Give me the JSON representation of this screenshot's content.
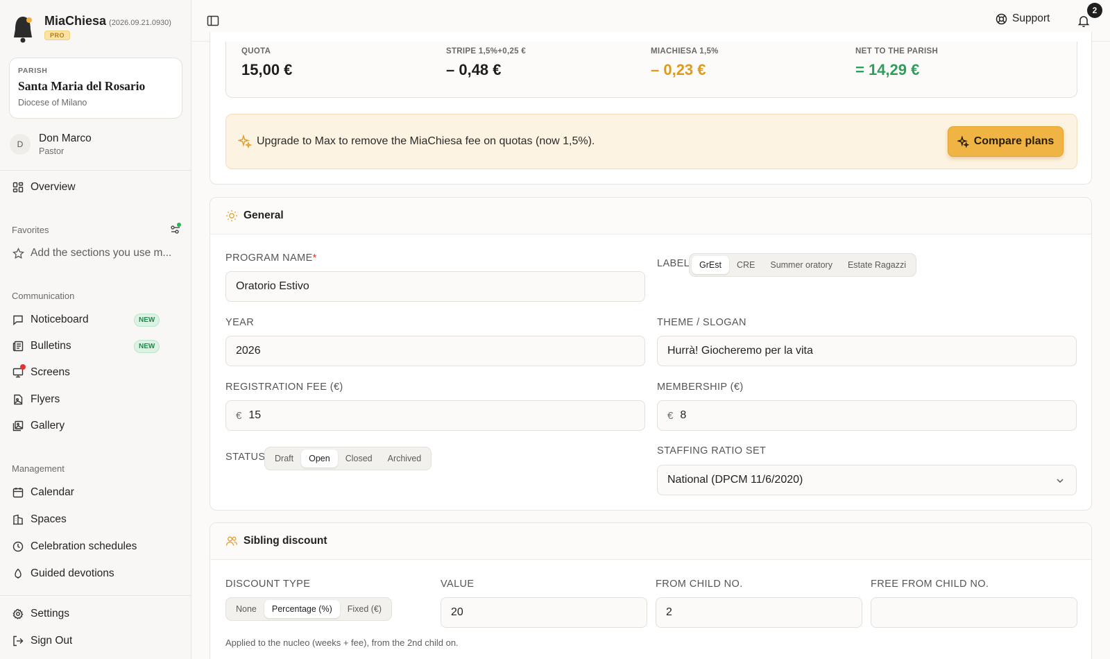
{
  "app": {
    "name": "MiaChiesa",
    "version": "(2026.09.21.0930)",
    "plan_badge": "PRO"
  },
  "parish": {
    "kicker": "PARISH",
    "name": "Santa Maria del Rosario",
    "diocese": "Diocese of Milano"
  },
  "user": {
    "initial": "D",
    "name": "Don Marco",
    "role": "Pastor"
  },
  "sidebar": {
    "overview": "Overview",
    "favorites_title": "Favorites",
    "favorites_hint": "Add the sections you use m...",
    "communication_title": "Communication",
    "communication": [
      {
        "label": "Noticeboard",
        "badge": "NEW"
      },
      {
        "label": "Bulletins",
        "badge": "NEW"
      },
      {
        "label": "Screens"
      },
      {
        "label": "Flyers"
      },
      {
        "label": "Gallery"
      }
    ],
    "management_title": "Management",
    "management": [
      {
        "label": "Calendar"
      },
      {
        "label": "Spaces"
      },
      {
        "label": "Celebration schedules"
      },
      {
        "label": "Guided devotions"
      }
    ],
    "settings": "Settings",
    "sign_out": "Sign Out"
  },
  "topbar": {
    "support": "Support",
    "notifications_count": "2"
  },
  "fees": [
    {
      "kicker": "QUOTA",
      "value": "15,00 €"
    },
    {
      "kicker": "STRIPE 1,5%+0,25 €",
      "value": "– 0,48 €"
    },
    {
      "kicker": "MIACHIESA 1,5%",
      "value": "– 0,23 €"
    },
    {
      "kicker": "NET TO THE PARISH",
      "value": "= 14,29 €"
    }
  ],
  "upgrade": {
    "text": "Upgrade to Max to remove the MiaChiesa fee on quotas (now 1,5%).",
    "button": "Compare plans"
  },
  "general": {
    "title": "General",
    "program_name_label": "PROGRAM NAME",
    "required_mark": "*",
    "program_name": "Oratorio Estivo",
    "label_label": "LABEL",
    "label_options": [
      "GrEst",
      "CRE",
      "Summer oratory",
      "Estate Ragazzi"
    ],
    "label_selected": "GrEst",
    "year_label": "YEAR",
    "year": "2026",
    "theme_label": "THEME / SLOGAN",
    "theme": "Hurrà! Giocheremo per la vita",
    "reg_fee_label": "REGISTRATION FEE (€)",
    "reg_fee": "15",
    "membership_label": "MEMBERSHIP (€)",
    "membership": "8",
    "currency_prefix": "€",
    "status_label": "STATUS",
    "status_options": [
      "Draft",
      "Open",
      "Closed",
      "Archived"
    ],
    "status_selected": "Open",
    "staffing_label": "STAFFING RATIO SET",
    "staffing": "National (DPCM 11/6/2020)"
  },
  "sibling": {
    "title": "Sibling discount",
    "discount_type_label": "DISCOUNT TYPE",
    "discount_options": [
      "None",
      "Percentage (%)",
      "Fixed (€)"
    ],
    "discount_selected": "Percentage (%)",
    "value_label": "VALUE",
    "value": "20",
    "from_child_label": "FROM CHILD NO.",
    "from_child": "2",
    "free_from_label": "FREE FROM CHILD NO.",
    "free_from": "",
    "helper": "Applied to the nucleo (weeks + fee), from the 2nd child on."
  }
}
